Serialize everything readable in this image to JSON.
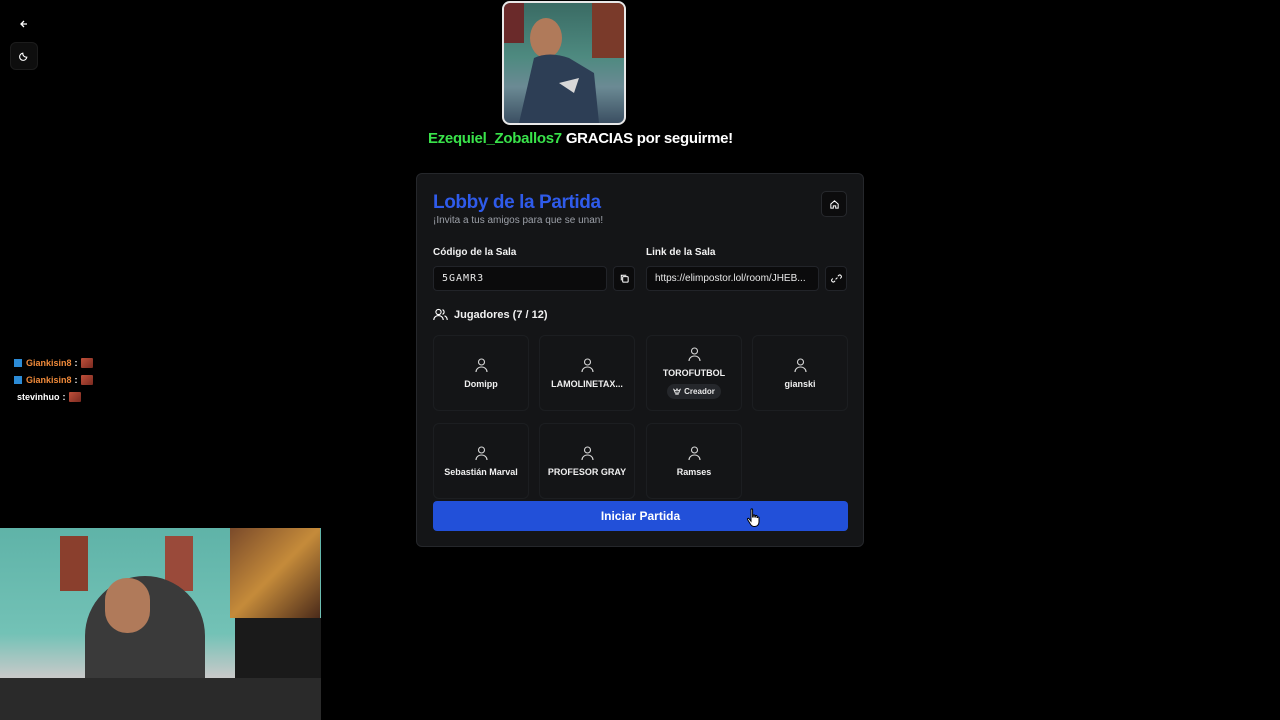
{
  "alert": {
    "username": "Ezequiel_Zoballos7",
    "message": "GRACIAS por seguirme!"
  },
  "chat": [
    {
      "user": "Giankisin8",
      "sep": ":",
      "badge": true,
      "color": "#f08a3a"
    },
    {
      "user": "Giankisin8",
      "sep": ":",
      "badge": true,
      "color": "#f08a3a"
    },
    {
      "user": "stevinhuo",
      "sep": ":",
      "badge": false,
      "color": "#ffffff"
    }
  ],
  "lobby": {
    "title": "Lobby de la Partida",
    "subtitle": "¡Invita a tus amigos para que se unan!",
    "room_code_label": "Código de la Sala",
    "room_code": "5GAMR3",
    "room_link_label": "Link de la Sala",
    "room_link": "https://elimpostor.lol/room/JHEB...",
    "players_label": "Jugadores (7 / 12)",
    "players": [
      {
        "name": "Domipp"
      },
      {
        "name": "LAMOLINETAX..."
      },
      {
        "name": "TOROFUTBOL",
        "badge": "Creador"
      },
      {
        "name": "gianski"
      },
      {
        "name": "Sebastián Marval"
      },
      {
        "name": "PROFESOR GRAY"
      },
      {
        "name": "Ramses"
      }
    ],
    "start_button": "Iniciar Partida"
  },
  "colors": {
    "accent": "#2250d9",
    "title": "#2f5bea",
    "alert_user": "#39e24a"
  },
  "icons": [
    "arrow-left-icon",
    "moon-icon",
    "home-icon",
    "copy-icon",
    "link-icon",
    "users-icon",
    "user-icon",
    "crown-icon",
    "hand-cursor-icon"
  ]
}
